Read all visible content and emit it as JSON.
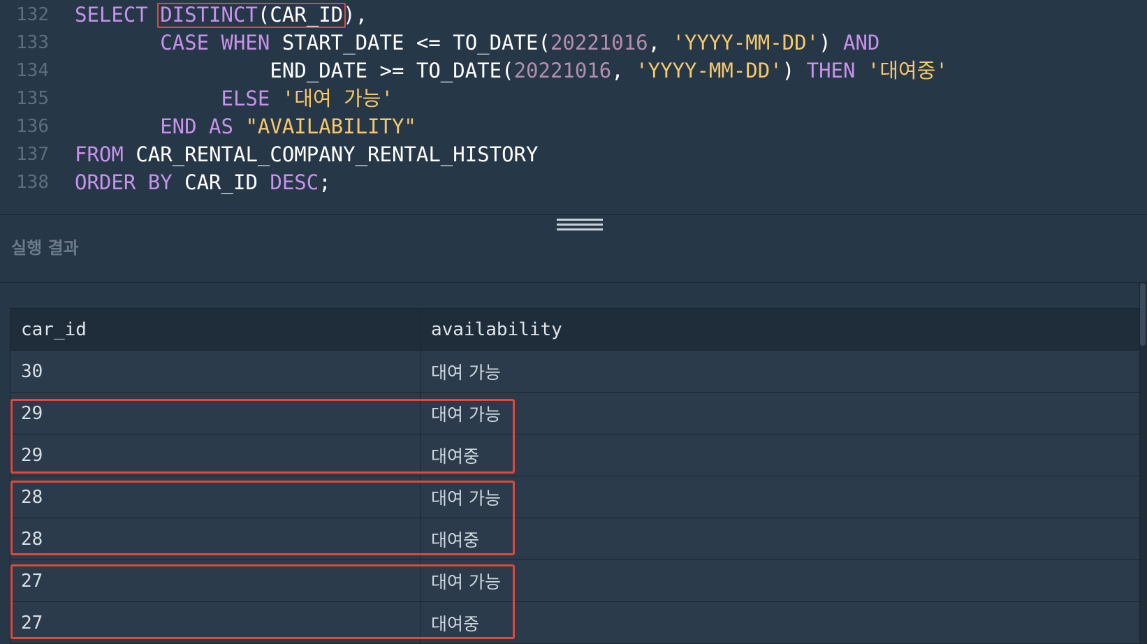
{
  "editor": {
    "lines": [
      {
        "no": "132",
        "tokens": [
          {
            "t": "SELECT ",
            "c": "kw"
          },
          {
            "t": "DISTINCT",
            "c": "kw"
          },
          {
            "t": "(CAR_ID)",
            "c": "id"
          },
          {
            "t": ",",
            "c": "id"
          }
        ]
      },
      {
        "no": "133",
        "indent": "       ",
        "tokens": [
          {
            "t": "CASE WHEN ",
            "c": "kw"
          },
          {
            "t": "START_DATE <= TO_DATE(",
            "c": "id"
          },
          {
            "t": "20221016",
            "c": "num"
          },
          {
            "t": ", ",
            "c": "id"
          },
          {
            "t": "'YYYY-MM-DD'",
            "c": "str"
          },
          {
            "t": ") ",
            "c": "id"
          },
          {
            "t": "AND",
            "c": "kw"
          }
        ]
      },
      {
        "no": "134",
        "indent": "                ",
        "tokens": [
          {
            "t": "END_DATE >= TO_DATE(",
            "c": "id"
          },
          {
            "t": "20221016",
            "c": "num"
          },
          {
            "t": ", ",
            "c": "id"
          },
          {
            "t": "'YYYY-MM-DD'",
            "c": "str"
          },
          {
            "t": ") ",
            "c": "id"
          },
          {
            "t": "THEN ",
            "c": "kw"
          },
          {
            "t": "'대여중'",
            "c": "str"
          }
        ]
      },
      {
        "no": "135",
        "indent": "            ",
        "tokens": [
          {
            "t": "ELSE ",
            "c": "kw"
          },
          {
            "t": "'대여 가능'",
            "c": "str"
          }
        ]
      },
      {
        "no": "136",
        "indent": "       ",
        "tokens": [
          {
            "t": "END AS ",
            "c": "kw"
          },
          {
            "t": "\"AVAILABILITY\"",
            "c": "str"
          }
        ]
      },
      {
        "no": "137",
        "tokens": [
          {
            "t": "FROM ",
            "c": "kw"
          },
          {
            "t": "CAR_RENTAL_COMPANY_RENTAL_HISTORY",
            "c": "id"
          }
        ]
      },
      {
        "no": "138",
        "tokens": [
          {
            "t": "ORDER BY ",
            "c": "kw"
          },
          {
            "t": "CAR_ID ",
            "c": "id"
          },
          {
            "t": "DESC",
            "c": "kw"
          },
          {
            "t": ";",
            "c": "id"
          }
        ]
      }
    ]
  },
  "results": {
    "title": "실행 결과",
    "columns": [
      "car_id",
      "availability"
    ],
    "rows": [
      [
        "30",
        "대여 가능"
      ],
      [
        "29",
        "대여 가능"
      ],
      [
        "29",
        "대여중"
      ],
      [
        "28",
        "대여 가능"
      ],
      [
        "28",
        "대여중"
      ],
      [
        "27",
        "대여 가능"
      ],
      [
        "27",
        "대여중"
      ]
    ]
  },
  "colors": {
    "background": "#263747",
    "keyword": "#c792ea",
    "string": "#f7c86b",
    "number": "#b48ead",
    "highlight": "#e0483a"
  }
}
